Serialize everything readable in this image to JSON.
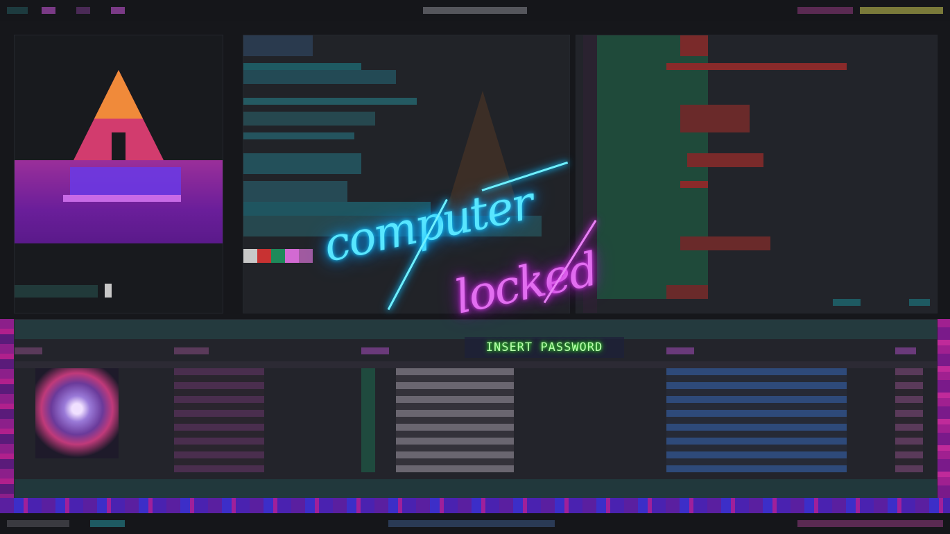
{
  "lock_screen": {
    "title_line1": "computer",
    "title_line2": "locked",
    "password_prompt": "INSERT PASSWORD"
  },
  "colors": {
    "neon_cyan": "#58e6ff",
    "neon_magenta": "#e26ef0",
    "prompt_green": "#b9ffae",
    "background": "#16171b"
  },
  "icons": {
    "distro_logo": "arch-logo-icon",
    "user_avatar": "avatar-icon"
  }
}
